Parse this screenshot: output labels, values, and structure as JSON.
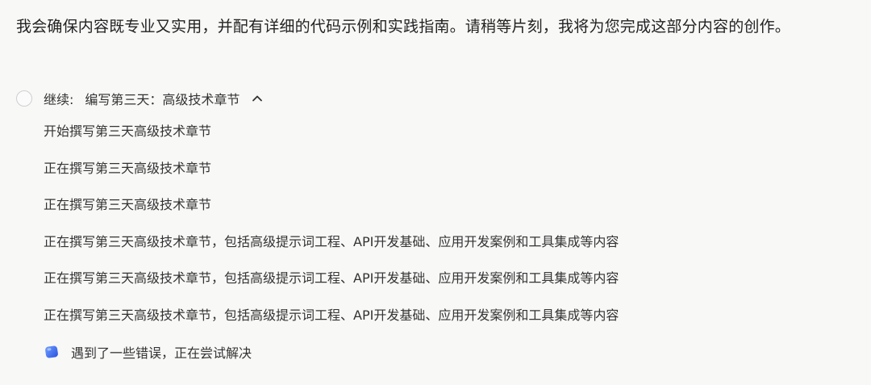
{
  "message": {
    "intro": "我会确保内容既专业又实用，并配有详细的代码示例和实践指南。请稍等片刻，我将为您完成这部分内容的创作。"
  },
  "task": {
    "prefix": "继续:",
    "title": "编写第三天：高级技术章节",
    "expand_icon": "chevron-up-icon",
    "status_icon": "pending-circle-icon",
    "steps": [
      "开始撰写第三天高级技术章节",
      "正在撰写第三天高级技术章节",
      "正在撰写第三天高级技术章节",
      "正在撰写第三天高级技术章节，包括高级提示词工程、API开发基础、应用开发案例和工具集成等内容",
      "正在撰写第三天高级技术章节，包括高级提示词工程、API开发基础、应用开发案例和工具集成等内容",
      "正在撰写第三天高级技术章节，包括高级提示词工程、API开发基础、应用开发案例和工具集成等内容"
    ],
    "error": {
      "icon": "blue-gem-icon",
      "text": "遇到了一些错误，正在尝试解决"
    }
  },
  "colors": {
    "background": "#f8f8f7",
    "text": "#333333",
    "accent": "#3b6cf6"
  }
}
